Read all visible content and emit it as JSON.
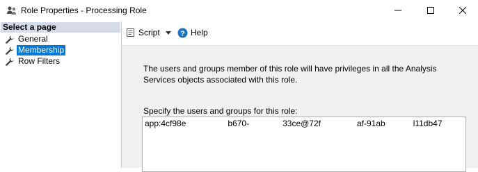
{
  "window": {
    "title": "Role Properties - Processing Role",
    "icon": "role-users-icon",
    "controls": [
      "minimize-icon",
      "maximize-icon",
      "close-icon"
    ]
  },
  "left_pane": {
    "header": "Select a page",
    "items": [
      {
        "label": "General",
        "icon": "wrench-icon",
        "selected": false
      },
      {
        "label": "Membership",
        "icon": "wrench-icon",
        "selected": true
      },
      {
        "label": "Row Filters",
        "icon": "wrench-icon",
        "selected": false
      }
    ]
  },
  "toolbar": {
    "script_label": "Script",
    "script_icon": "script-icon",
    "dropdown_icon": "chevron-down-icon",
    "help_label": "Help",
    "help_icon": "help-icon"
  },
  "main": {
    "description": "The users and groups member of this role will have privileges in all the Analysis Services objects associated with this role.",
    "members_label": "Specify the users and groups for this role:",
    "members": [
      {
        "segments": [
          "app:4cf98e",
          "b670-",
          "33ce@72f",
          "af-91ab",
          "l11db47"
        ]
      }
    ]
  },
  "colors": {
    "selection": "#0078d7",
    "header_bg": "#d6dbe9",
    "pane_bg": "#f0f0f0"
  }
}
